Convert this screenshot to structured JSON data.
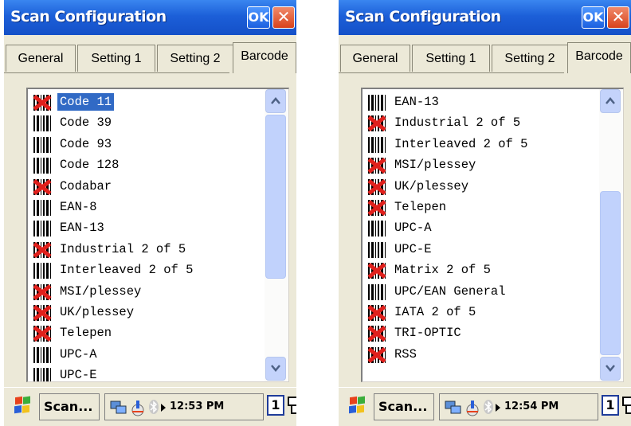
{
  "windows": [
    {
      "title": "Scan Configuration",
      "ok_label": "OK",
      "close_label": "✕",
      "tabs": [
        "General",
        "Setting 1",
        "Setting 2",
        "Barcode"
      ],
      "active_tab": "Barcode",
      "items": [
        {
          "label": "Code 11",
          "enabled": false,
          "selected": true
        },
        {
          "label": "Code 39",
          "enabled": true
        },
        {
          "label": "Code 93",
          "enabled": true
        },
        {
          "label": "Code 128",
          "enabled": true
        },
        {
          "label": "Codabar",
          "enabled": false
        },
        {
          "label": "EAN-8",
          "enabled": true
        },
        {
          "label": "EAN-13",
          "enabled": true
        },
        {
          "label": "Industrial 2 of 5",
          "enabled": false
        },
        {
          "label": "Interleaved 2 of 5",
          "enabled": true
        },
        {
          "label": "MSI/plessey",
          "enabled": false
        },
        {
          "label": "UK/plessey",
          "enabled": false
        },
        {
          "label": "Telepen",
          "enabled": false
        },
        {
          "label": "UPC-A",
          "enabled": true
        },
        {
          "label": "UPC-E",
          "enabled": true
        }
      ],
      "scroll_position": "top",
      "taskbar": {
        "task_label": "Scan...",
        "clock": "12:53 PM",
        "page_indicator": "1"
      }
    },
    {
      "title": "Scan Configuration",
      "ok_label": "OK",
      "close_label": "✕",
      "tabs": [
        "General",
        "Setting 1",
        "Setting 2",
        "Barcode"
      ],
      "active_tab": "Barcode",
      "items": [
        {
          "label": "EAN-13",
          "enabled": true
        },
        {
          "label": "Industrial 2 of 5",
          "enabled": false
        },
        {
          "label": "Interleaved 2 of 5",
          "enabled": true
        },
        {
          "label": "MSI/plessey",
          "enabled": false
        },
        {
          "label": "UK/plessey",
          "enabled": false
        },
        {
          "label": "Telepen",
          "enabled": false
        },
        {
          "label": "UPC-A",
          "enabled": true
        },
        {
          "label": "UPC-E",
          "enabled": true
        },
        {
          "label": "Matrix 2 of 5",
          "enabled": false
        },
        {
          "label": "UPC/EAN General",
          "enabled": true
        },
        {
          "label": "IATA 2 of 5",
          "enabled": false
        },
        {
          "label": "TRI-OPTIC",
          "enabled": false
        },
        {
          "label": "RSS",
          "enabled": false
        }
      ],
      "scroll_position": "bottom",
      "taskbar": {
        "task_label": "Scan...",
        "clock": "12:54 PM",
        "page_indicator": "1"
      }
    }
  ],
  "colors": {
    "title_bar": "#1c5fd8",
    "selection": "#316ac5",
    "disabled_icon": "#e0201c",
    "scroll_thumb": "#c1d2fc"
  }
}
